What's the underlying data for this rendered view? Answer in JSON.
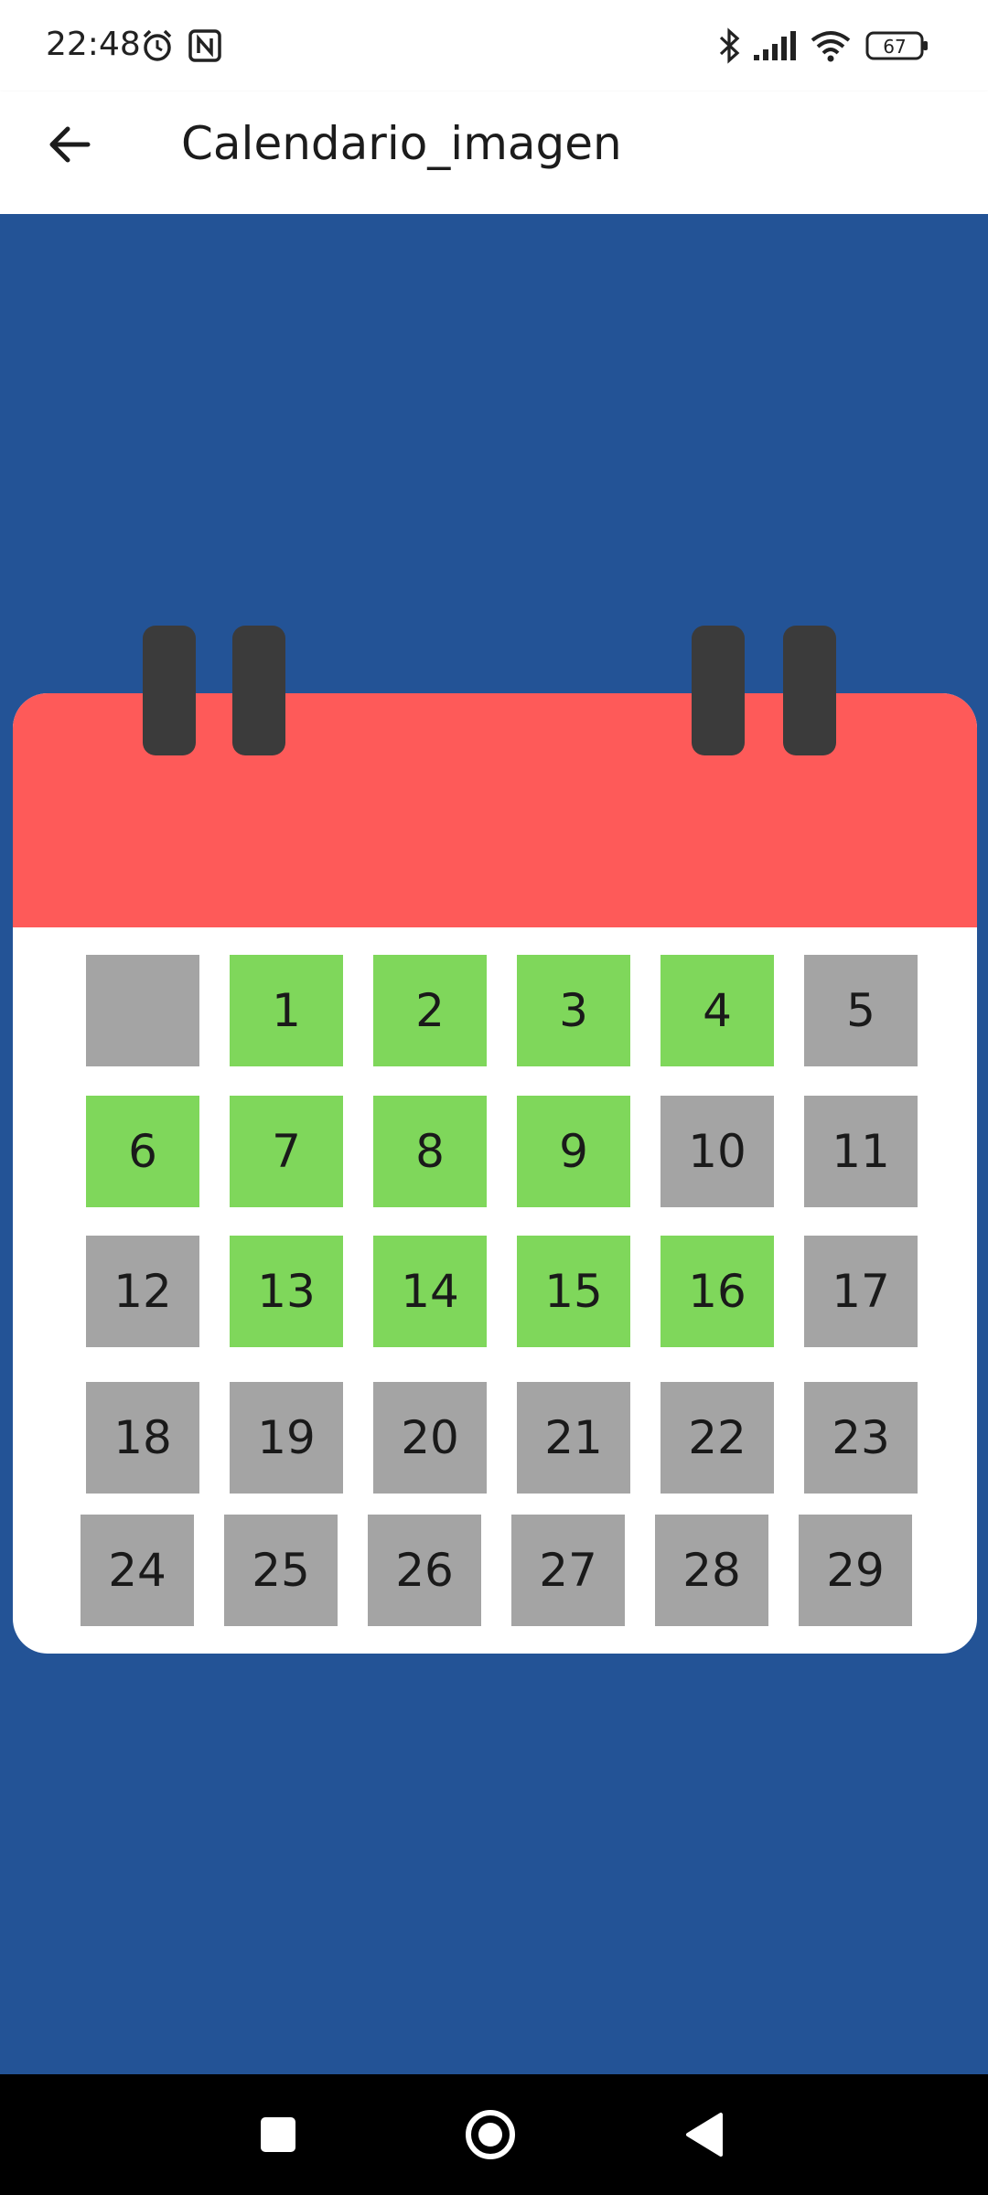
{
  "status_bar": {
    "time": "22:48",
    "battery": "67",
    "icons": [
      "alarm-icon",
      "nfc-icon",
      "bluetooth-icon",
      "signal-icon",
      "wifi-icon",
      "battery-icon"
    ]
  },
  "app_bar": {
    "title": "Calendario_imagen",
    "back_icon": "arrow-left-icon"
  },
  "colors": {
    "background": "#235396",
    "calendar_header": "#fe5a59",
    "calendar_ring": "#3b3b3b",
    "day_highlighted": "#7fd75b",
    "day_default": "#a4a4a4"
  },
  "calendar": {
    "days": [
      {
        "label": "",
        "state": "gray"
      },
      {
        "label": "1",
        "state": "green"
      },
      {
        "label": "2",
        "state": "green"
      },
      {
        "label": "3",
        "state": "green"
      },
      {
        "label": "4",
        "state": "green"
      },
      {
        "label": "5",
        "state": "gray"
      },
      {
        "label": "6",
        "state": "green"
      },
      {
        "label": "7",
        "state": "green"
      },
      {
        "label": "8",
        "state": "green"
      },
      {
        "label": "9",
        "state": "green"
      },
      {
        "label": "10",
        "state": "gray"
      },
      {
        "label": "11",
        "state": "gray"
      },
      {
        "label": "12",
        "state": "gray"
      },
      {
        "label": "13",
        "state": "green"
      },
      {
        "label": "14",
        "state": "green"
      },
      {
        "label": "15",
        "state": "green"
      },
      {
        "label": "16",
        "state": "green"
      },
      {
        "label": "17",
        "state": "gray"
      },
      {
        "label": "18",
        "state": "gray"
      },
      {
        "label": "19",
        "state": "gray"
      },
      {
        "label": "20",
        "state": "gray"
      },
      {
        "label": "21",
        "state": "gray"
      },
      {
        "label": "22",
        "state": "gray"
      },
      {
        "label": "23",
        "state": "gray"
      },
      {
        "label": "24",
        "state": "gray"
      },
      {
        "label": "25",
        "state": "gray"
      },
      {
        "label": "26",
        "state": "gray"
      },
      {
        "label": "27",
        "state": "gray"
      },
      {
        "label": "28",
        "state": "gray"
      },
      {
        "label": "29",
        "state": "gray"
      }
    ]
  },
  "nav_bar": {
    "buttons": [
      "recents-square-icon",
      "home-circle-icon",
      "back-triangle-icon"
    ]
  }
}
